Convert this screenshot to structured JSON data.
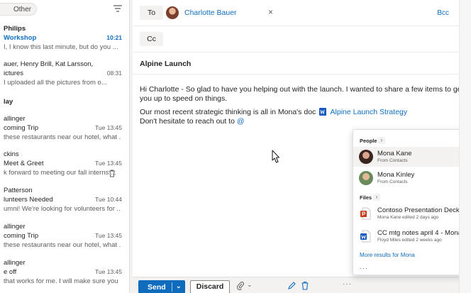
{
  "list": {
    "tab_other": "Other",
    "day_header": "lay",
    "messages": [
      {
        "sender": "Philips",
        "subject": "Workshop",
        "time": "10:21",
        "preview": "I, I know this last minute, but do you ..."
      },
      {
        "sender": "auer, Henry Brill, Kat Larsson,",
        "subject": "ictures",
        "time": "08:31",
        "preview": "I uploaded all the pictures from o..."
      },
      {
        "sender": "allinger",
        "subject": "coming Trip",
        "time": "Tue 13:45",
        "preview": "these restaurants near our hotel, what ..."
      },
      {
        "sender": "ckins",
        "subject": "Meet & Greet",
        "time": "Tue 13:45",
        "preview": "k forward to meeting our fall interns ..."
      },
      {
        "sender": "Patterson",
        "subject": "lunteers Needed",
        "time": "Tue 10:44",
        "preview": "umni! We're looking for volunteers for ..."
      },
      {
        "sender": "allinger",
        "subject": "coming Trip",
        "time": "Tue 13:45",
        "preview": "these restaurants near our hotel, what ..."
      },
      {
        "sender": "allinger",
        "subject": "e off",
        "time": "Tue 13:45",
        "preview": "that works for me. I will make sure you ..."
      }
    ]
  },
  "compose": {
    "to_label": "To",
    "cc_label": "Cc",
    "bcc_label": "Bcc",
    "recipient": "Charlotte Bauer",
    "subject": "Alpine Launch",
    "body_line1": "Hi Charlotte - So glad to have you helping out with the launch. I wanted to share a few items to get",
    "body_line2": "you up to speed on things.",
    "body_line3_prefix": "Our most recent strategic thinking is all in Mona's doc",
    "body_line3_link": "Alpine Launch Strategy",
    "body_line4_prefix": "Don't hesitate to reach out to",
    "body_line4_mention": "@"
  },
  "mention_popup": {
    "people_header": "People",
    "people": [
      {
        "name": "Mona Kane",
        "source": "From Contacts"
      },
      {
        "name": "Mona Kinley",
        "source": "From Contacts"
      }
    ],
    "files_header": "Files",
    "files": [
      {
        "name": "Contoso Presentation Deck",
        "meta": "Mona Kane edited 2 days ago",
        "type": "powerpoint-icon"
      },
      {
        "name": "CC mtg notes april 4 - Mona",
        "meta": "Floyd Miles edited 2 weeks ago",
        "type": "word-icon"
      }
    ],
    "more_results": "More results for Mona",
    "more_glyph": "···",
    "chevron_glyph": "›"
  },
  "toolbar": {
    "send_label": "Send",
    "discard_label": "Discard",
    "more_glyph": "···"
  },
  "colors": {
    "accent": "#0f6cbd",
    "powerpoint": "#c43e1c",
    "word": "#185abd"
  }
}
